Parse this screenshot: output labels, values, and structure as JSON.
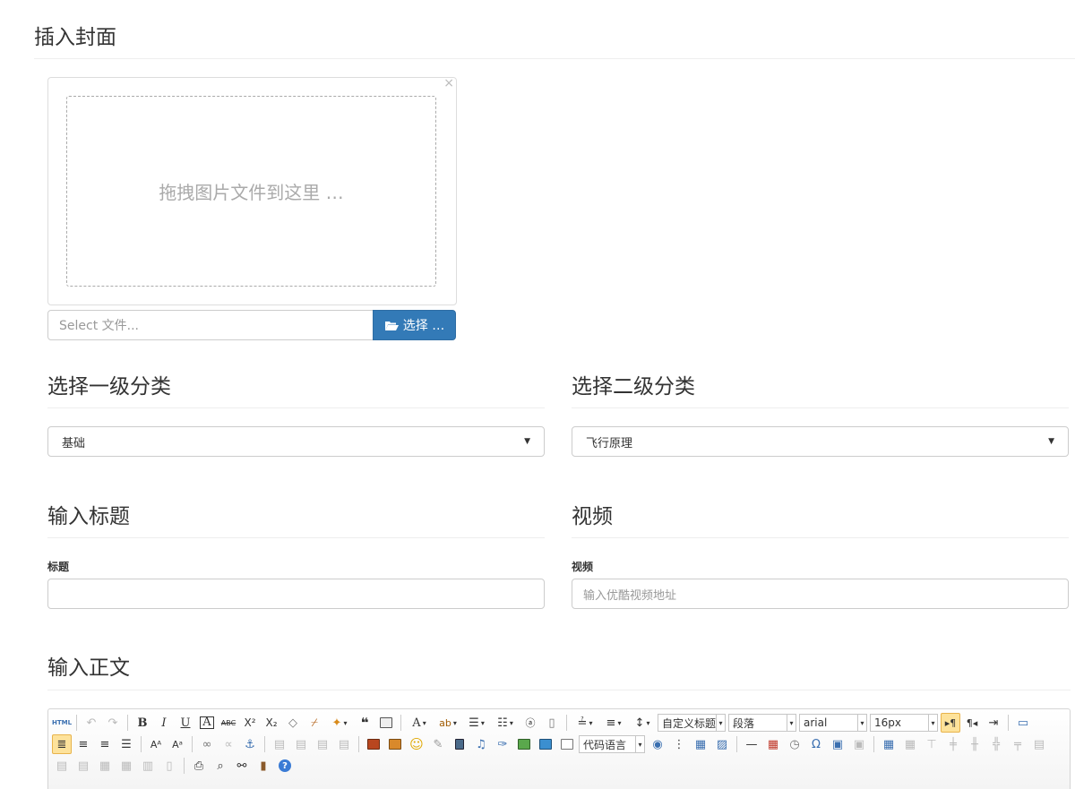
{
  "cover": {
    "heading": "插入封面",
    "close_icon": "×",
    "drop_text": "拖拽图片文件到这里 …",
    "file_placeholder": "Select 文件...",
    "browse_label": "选择 …"
  },
  "category1": {
    "heading": "选择一级分类",
    "selected": "基础"
  },
  "category2": {
    "heading": "选择二级分类",
    "selected": "飞行原理"
  },
  "title_section": {
    "heading": "输入标题",
    "label": "标题",
    "value": ""
  },
  "video_section": {
    "heading": "视频",
    "label": "视频",
    "placeholder": "输入优酷视频地址"
  },
  "body_section": {
    "heading": "输入正文"
  },
  "editor": {
    "html_label": "HTML",
    "custom_heading": "自定义标题",
    "paragraph": "段落",
    "font_family": "arial",
    "font_size": "16px",
    "code_language": "代码语言"
  },
  "colors": {
    "primary_button": "#337ab7",
    "active_tool": "#fde29b"
  }
}
